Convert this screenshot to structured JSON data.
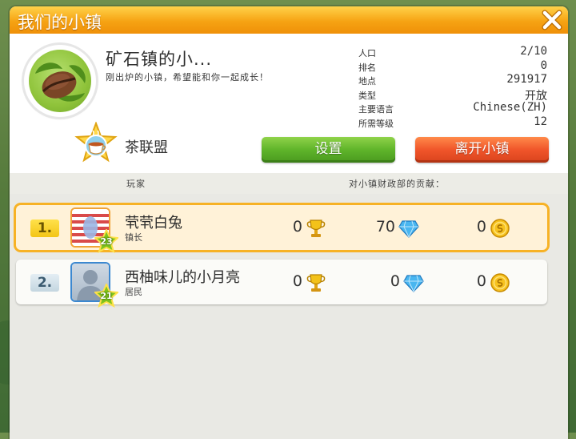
{
  "window": {
    "title": "我们的小镇"
  },
  "town": {
    "name": "矿石镇的小...",
    "description": "刚出炉的小镇，希望能和你一起成长！",
    "stats": [
      {
        "label": "人口",
        "value": "2/10"
      },
      {
        "label": "排名",
        "value": "0"
      },
      {
        "label": "地点",
        "value": "291917"
      },
      {
        "label": "类型",
        "value": "开放"
      },
      {
        "label": "主要语言",
        "value": "Chinese(ZH)"
      },
      {
        "label": "所需等级",
        "value": "12"
      }
    ],
    "alliance": "茶联盟"
  },
  "buttons": {
    "settings": "设置",
    "leave": "离开小镇"
  },
  "list_header": {
    "player": "玩家",
    "contribution": "对小镇财政部的贡献："
  },
  "players": [
    {
      "rank": "1.",
      "name": "茕茕白兔",
      "role": "镇长",
      "level": "23",
      "trophies": "0",
      "diamonds": "70",
      "coins": "0"
    },
    {
      "rank": "2.",
      "name": "西柚味儿的小月亮",
      "role": "居民",
      "level": "21",
      "trophies": "0",
      "diamonds": "0",
      "coins": "0"
    }
  ],
  "icons": {
    "close": "close-icon",
    "town_emblem": "coffee-bean-icon",
    "alliance": "tea-cup-badge-icon",
    "trophy": "trophy-icon",
    "diamond": "diamond-icon",
    "coin": "coin-icon",
    "level": "star-level-icon"
  },
  "colors": {
    "title_bar": "#f6a313",
    "settings_button": "#5fb42a",
    "leave_button": "#f0552a",
    "self_highlight": "#f7b225"
  }
}
